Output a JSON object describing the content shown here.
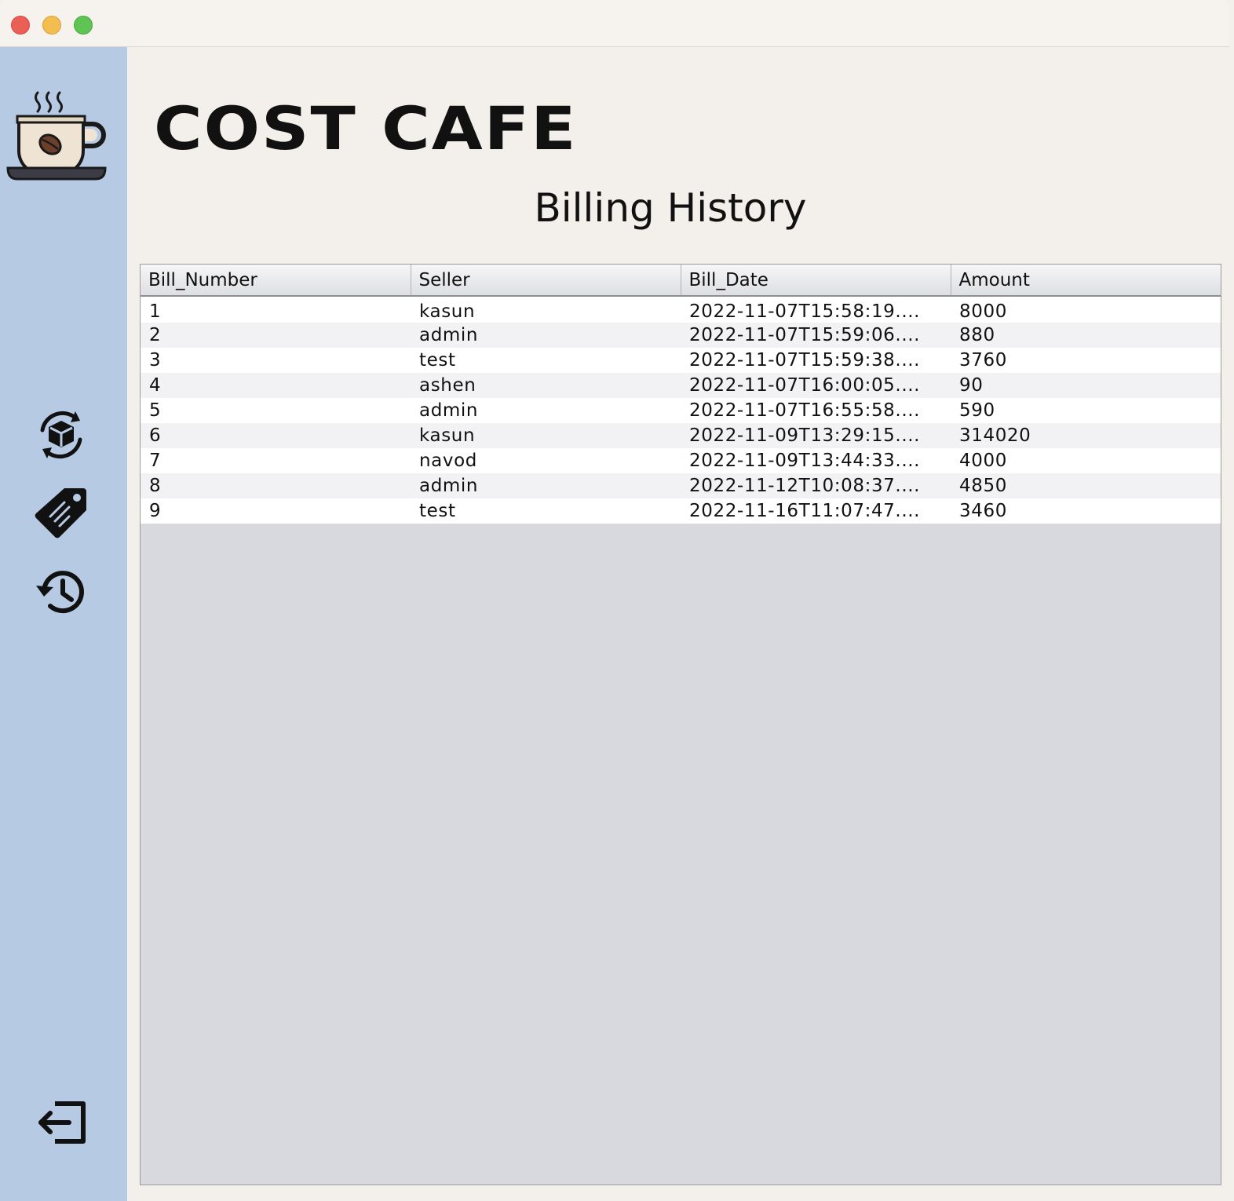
{
  "app": {
    "brand": "COST CAFE",
    "page_title": "Billing History"
  },
  "sidebar": {
    "items": [
      {
        "name": "inventory",
        "icon": "box-refresh-icon"
      },
      {
        "name": "pricing",
        "icon": "price-tag-icon"
      },
      {
        "name": "history",
        "icon": "history-icon"
      },
      {
        "name": "logout",
        "icon": "logout-icon"
      }
    ]
  },
  "table": {
    "columns": [
      "Bill_Number",
      "Seller",
      "Bill_Date",
      "Amount"
    ],
    "rows": [
      [
        "1",
        "kasun",
        "2022-11-07T15:58:19....",
        "8000"
      ],
      [
        "2",
        "admin",
        "2022-11-07T15:59:06....",
        "880"
      ],
      [
        "3",
        "test",
        "2022-11-07T15:59:38....",
        "3760"
      ],
      [
        "4",
        "ashen",
        "2022-11-07T16:00:05....",
        "90"
      ],
      [
        "5",
        "admin",
        "2022-11-07T16:55:58....",
        "590"
      ],
      [
        "6",
        "kasun",
        "2022-11-09T13:29:15....",
        "314020"
      ],
      [
        "7",
        "navod",
        "2022-11-09T13:44:33....",
        "4000"
      ],
      [
        "8",
        "admin",
        "2022-11-12T10:08:37....",
        "4850"
      ],
      [
        "9",
        "test",
        "2022-11-16T11:07:47....",
        "3460"
      ]
    ]
  },
  "colors": {
    "sidebar_bg": "#b7cae4",
    "content_bg": "#f3efea",
    "table_empty_bg": "#d8d9df"
  }
}
